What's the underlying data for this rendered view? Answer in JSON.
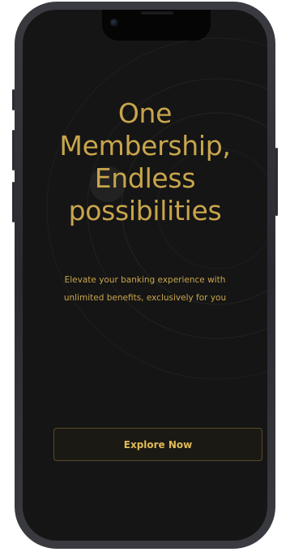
{
  "hero": {
    "title_lines": [
      "One",
      "Membership,",
      "Endless",
      "possibilities"
    ],
    "subtitle_lines": [
      "Elevate your banking experience with",
      "unlimited benefits, exclusively for you"
    ]
  },
  "cta": {
    "label": "Explore Now"
  },
  "colors": {
    "accent_gold": "#c9a54c",
    "screen_background": "#151515",
    "button_background": "#1b1913",
    "button_border": "#5a4c2a"
  },
  "icons": {
    "front_camera": "front-camera-icon"
  }
}
